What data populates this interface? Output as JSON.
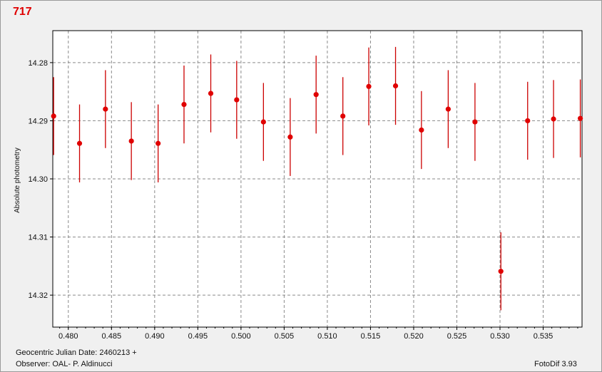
{
  "title": "717",
  "footer": {
    "date_line": "Geocentric Julian Date: 2460213 +",
    "observer_line": "Observer: OAL- P. Aldinucci",
    "software": "FotoDif 3.93"
  },
  "chart_data": {
    "type": "scatter",
    "title": "717",
    "xlabel": "",
    "ylabel": "Absolute photometry",
    "x_ticks": [
      "0.480",
      "0.485",
      "0.490",
      "0.495",
      "0.500",
      "0.505",
      "0.510",
      "0.515",
      "0.520",
      "0.525",
      "0.530",
      "0.535"
    ],
    "y_ticks": [
      "14.28",
      "14.29",
      "14.30",
      "14.31",
      "14.32"
    ],
    "xlim": [
      0.4782,
      0.5395
    ],
    "ylim": [
      14.3255,
      14.2745
    ],
    "y_inverted": true,
    "grid": true,
    "marker_color": "#e00000",
    "errorbar_color": "#cc0000",
    "points": [
      {
        "x": 0.4783,
        "y": 14.2892,
        "err": 0.0067
      },
      {
        "x": 0.4813,
        "y": 14.2939,
        "err": 0.0067
      },
      {
        "x": 0.4843,
        "y": 14.288,
        "err": 0.0067
      },
      {
        "x": 0.4873,
        "y": 14.2935,
        "err": 0.0067
      },
      {
        "x": 0.4904,
        "y": 14.2939,
        "err": 0.0067
      },
      {
        "x": 0.4934,
        "y": 14.2872,
        "err": 0.0067
      },
      {
        "x": 0.4965,
        "y": 14.2853,
        "err": 0.0067
      },
      {
        "x": 0.4995,
        "y": 14.2864,
        "err": 0.0067
      },
      {
        "x": 0.5026,
        "y": 14.2902,
        "err": 0.0067
      },
      {
        "x": 0.5057,
        "y": 14.2928,
        "err": 0.0067
      },
      {
        "x": 0.5087,
        "y": 14.2855,
        "err": 0.0067
      },
      {
        "x": 0.5118,
        "y": 14.2892,
        "err": 0.0067
      },
      {
        "x": 0.5148,
        "y": 14.2841,
        "err": 0.0067
      },
      {
        "x": 0.5179,
        "y": 14.284,
        "err": 0.0067
      },
      {
        "x": 0.5209,
        "y": 14.2916,
        "err": 0.0067
      },
      {
        "x": 0.524,
        "y": 14.288,
        "err": 0.0067
      },
      {
        "x": 0.5271,
        "y": 14.2902,
        "err": 0.0067
      },
      {
        "x": 0.5301,
        "y": 14.3159,
        "err": 0.0067
      },
      {
        "x": 0.5332,
        "y": 14.29,
        "err": 0.0067
      },
      {
        "x": 0.5362,
        "y": 14.2897,
        "err": 0.0067
      },
      {
        "x": 0.5393,
        "y": 14.2896,
        "err": 0.0067
      }
    ]
  }
}
